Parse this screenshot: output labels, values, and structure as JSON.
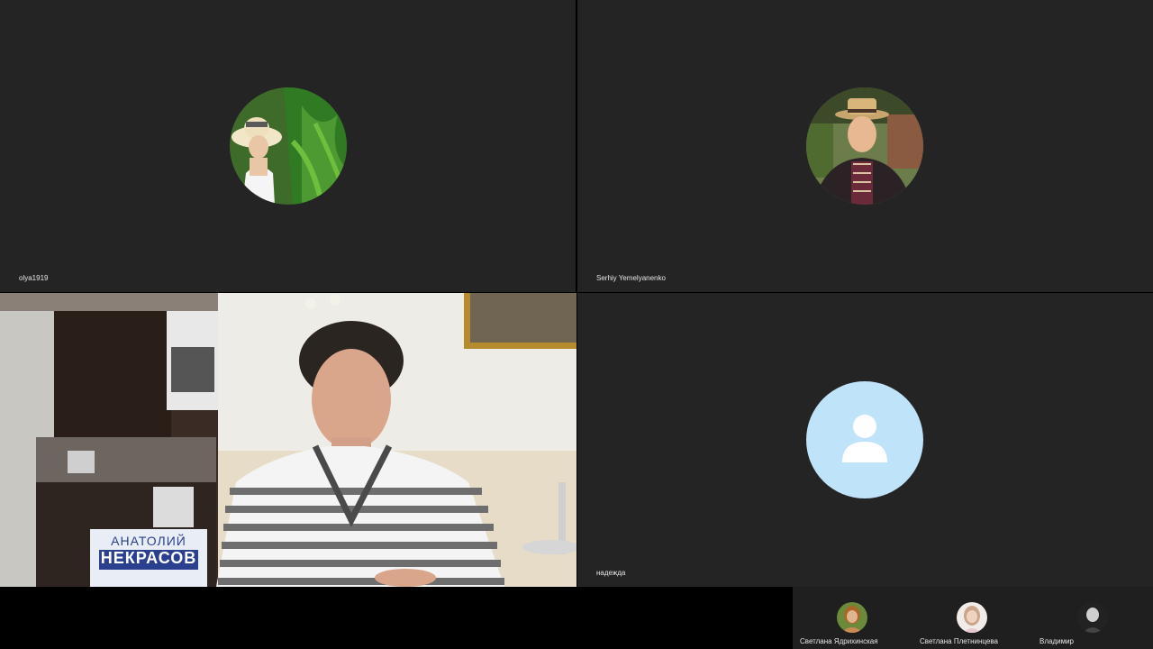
{
  "participants": [
    {
      "name": "olya1919",
      "avatar": "photo-avatar-hat-woman"
    },
    {
      "name": "Serhiy Yemelyanenko",
      "avatar": "photo-avatar-hat-man"
    },
    {
      "name": "",
      "video": "live-video-speaker",
      "book_author": "АНАТОЛИЙ",
      "book_title": "НЕКРАСОВ"
    },
    {
      "name": "надежда",
      "avatar": "default-user-icon"
    }
  ],
  "strip": [
    {
      "name": "Светлана Ядрихинская"
    },
    {
      "name": "Светлана Плетнинцева"
    },
    {
      "name": "Владимир"
    }
  ],
  "colors": {
    "tile_bg": "#242424",
    "default_avatar_bg": "#bfe3f8",
    "strip_bg": "#1f1f1f"
  }
}
